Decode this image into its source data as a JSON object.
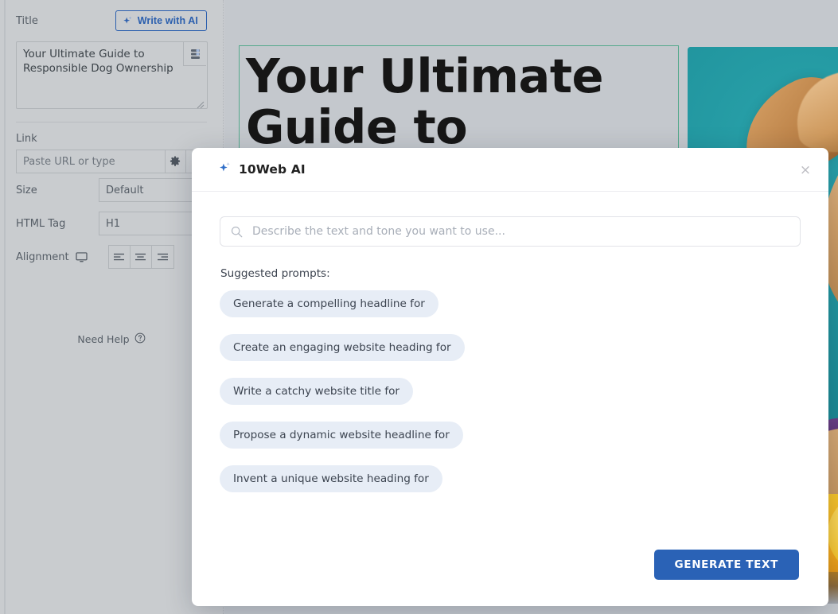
{
  "sidebar": {
    "title_label": "Title",
    "write_with_ai_label": "Write with AI",
    "title_value": "Your Ultimate Guide to Responsible Dog Ownership",
    "dynamic_tags_icon": "database-stack-icon",
    "link_label": "Link",
    "link_placeholder": "Paste URL or type",
    "link_settings_icon": "gear-icon",
    "size_label": "Size",
    "size_value": "Default",
    "html_tag_label": "HTML Tag",
    "html_tag_value": "H1",
    "alignment_label": "Alignment",
    "alignment_device_icon": "monitor-icon",
    "alignment_options": [
      "align-left",
      "align-center",
      "align-right"
    ],
    "need_help_label": "Need Help",
    "need_help_icon": "question-circle-icon"
  },
  "canvas": {
    "heading_text": "Your Ultimate\nGuide to",
    "selection_color": "#55a98c"
  },
  "modal": {
    "title": "10Web AI",
    "title_icon": "sparkle-icon",
    "close_label": "×",
    "search_placeholder": "Describe the text and tone you want to use...",
    "search_value": "",
    "search_icon": "search-icon",
    "suggested_label": "Suggested prompts:",
    "prompts": [
      "Generate a compelling headline for",
      "Create an engaging website heading for",
      "Write a catchy website title for",
      "Propose a dynamic website headline for",
      "Invent a unique website heading for"
    ],
    "generate_label": "GENERATE TEXT",
    "accent_color": "#2a62b6",
    "chip_color": "#e7edf6"
  }
}
